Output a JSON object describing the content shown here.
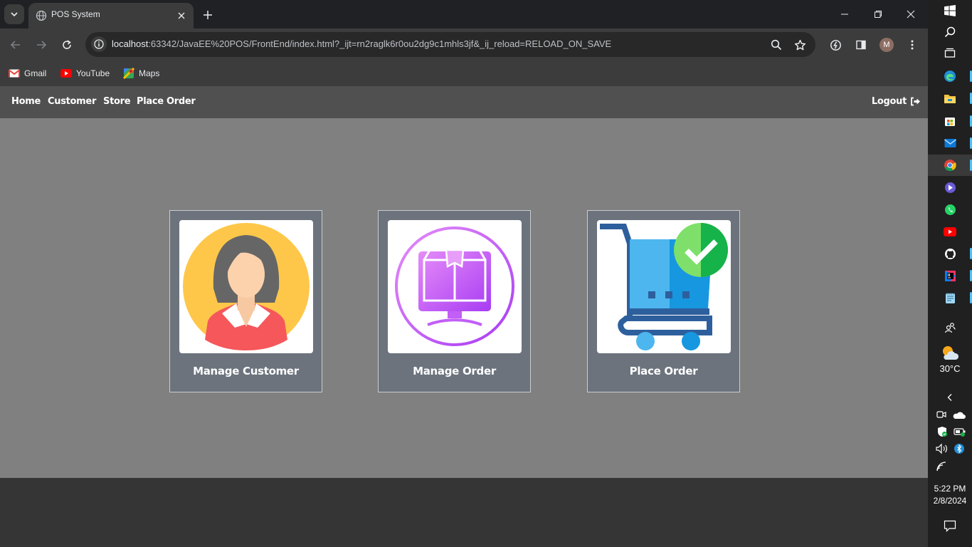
{
  "browser": {
    "tab_title": "POS System",
    "url_host": "localhost",
    "url_rest": ":63342/JavaEE%20POS/FrontEnd/index.html?_ijt=rn2raglk6r0ou2dg9c1mhls3jf&_ij_reload=RELOAD_ON_SAVE",
    "profile_initial": "M",
    "bookmarks": [
      {
        "label": "Gmail",
        "icon": "gmail-icon"
      },
      {
        "label": "YouTube",
        "icon": "youtube-icon"
      },
      {
        "label": "Maps",
        "icon": "maps-icon"
      }
    ]
  },
  "navbar": {
    "links": [
      "Home",
      "Customer",
      "Store",
      "Place Order"
    ],
    "logout_label": "Logout"
  },
  "cards": [
    {
      "label": "Manage Customer",
      "icon": "customer-avatar-icon"
    },
    {
      "label": "Manage Order",
      "icon": "order-box-icon"
    },
    {
      "label": "Place Order",
      "icon": "shopping-cart-check-icon"
    }
  ],
  "taskbar": {
    "temperature": "30°C",
    "time": "5:22 PM",
    "date": "2/8/2024"
  },
  "colors": {
    "page_bg": "#7f807f",
    "navbar_bg": "#505050",
    "card_bg": "#6c737d"
  }
}
